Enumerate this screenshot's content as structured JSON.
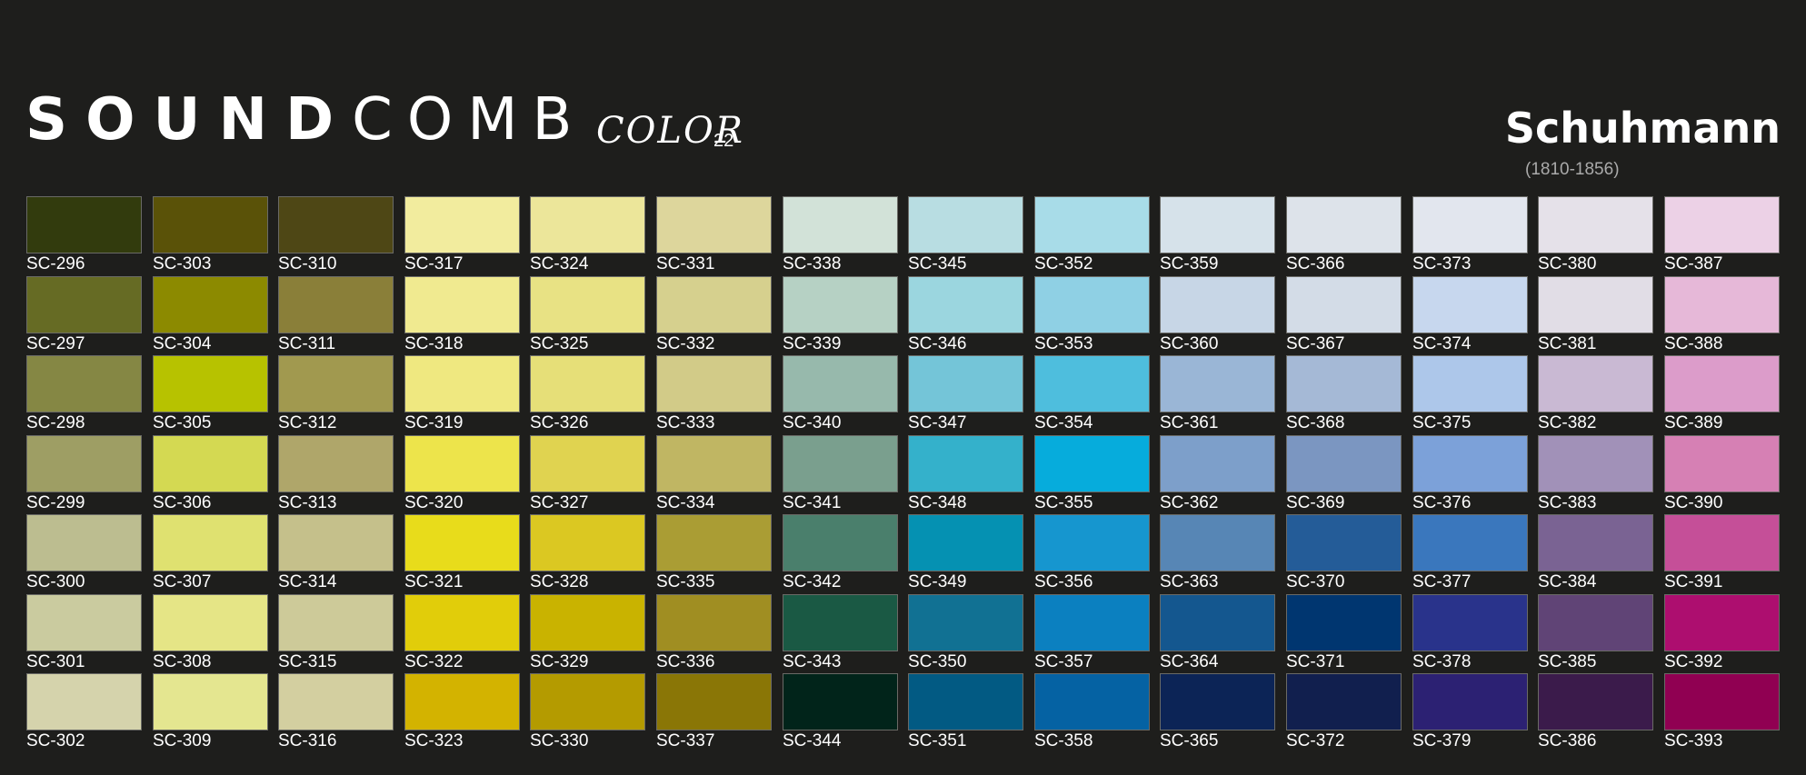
{
  "header": {
    "brand_bold": "SOUND",
    "brand_light": "COMB",
    "collection": "COLOR",
    "collection_number": "22",
    "maker": "Schuhmann",
    "maker_years": "(1810-1856)"
  },
  "swatch_columns": [
    [
      {
        "code": "SC-296",
        "color": "#323b0d"
      },
      {
        "code": "SC-297",
        "color": "#666b24"
      },
      {
        "code": "SC-298",
        "color": "#858744"
      },
      {
        "code": "SC-299",
        "color": "#9e9e64"
      },
      {
        "code": "SC-300",
        "color": "#bcbd90"
      },
      {
        "code": "SC-301",
        "color": "#cacb9f"
      },
      {
        "code": "SC-302",
        "color": "#d5d3ac"
      }
    ],
    [
      {
        "code": "SC-303",
        "color": "#5a5208"
      },
      {
        "code": "SC-304",
        "color": "#8c8a00"
      },
      {
        "code": "SC-305",
        "color": "#b7c200"
      },
      {
        "code": "SC-306",
        "color": "#d4d952"
      },
      {
        "code": "SC-307",
        "color": "#dfe170"
      },
      {
        "code": "SC-308",
        "color": "#e5e586"
      },
      {
        "code": "SC-309",
        "color": "#e4e690"
      }
    ],
    [
      {
        "code": "SC-310",
        "color": "#4e4715"
      },
      {
        "code": "SC-311",
        "color": "#8a7f39"
      },
      {
        "code": "SC-312",
        "color": "#a1994f"
      },
      {
        "code": "SC-313",
        "color": "#afa66a"
      },
      {
        "code": "SC-314",
        "color": "#c5c08b"
      },
      {
        "code": "SC-315",
        "color": "#cdca99"
      },
      {
        "code": "SC-316",
        "color": "#d3cfa0"
      }
    ],
    [
      {
        "code": "SC-317",
        "color": "#f2ec9e"
      },
      {
        "code": "SC-318",
        "color": "#f0ea90"
      },
      {
        "code": "SC-319",
        "color": "#efe880"
      },
      {
        "code": "SC-320",
        "color": "#ede44b"
      },
      {
        "code": "SC-321",
        "color": "#e8dc1b"
      },
      {
        "code": "SC-322",
        "color": "#e1cd0a"
      },
      {
        "code": "SC-323",
        "color": "#d3b300"
      }
    ],
    [
      {
        "code": "SC-324",
        "color": "#ece69a"
      },
      {
        "code": "SC-325",
        "color": "#e8e284"
      },
      {
        "code": "SC-326",
        "color": "#e6df78"
      },
      {
        "code": "SC-327",
        "color": "#e0d350"
      },
      {
        "code": "SC-328",
        "color": "#dbc822"
      },
      {
        "code": "SC-329",
        "color": "#c9b300"
      },
      {
        "code": "SC-330",
        "color": "#b49b00"
      }
    ],
    [
      {
        "code": "SC-331",
        "color": "#ddd69c"
      },
      {
        "code": "SC-332",
        "color": "#d6d08e"
      },
      {
        "code": "SC-333",
        "color": "#d2cb88"
      },
      {
        "code": "SC-334",
        "color": "#c0b663"
      },
      {
        "code": "SC-335",
        "color": "#aa9d34"
      },
      {
        "code": "SC-336",
        "color": "#a08e22"
      },
      {
        "code": "SC-337",
        "color": "#8a7606"
      }
    ],
    [
      {
        "code": "SC-338",
        "color": "#d2e2d8"
      },
      {
        "code": "SC-339",
        "color": "#b6d1c4"
      },
      {
        "code": "SC-340",
        "color": "#97b9ac"
      },
      {
        "code": "SC-341",
        "color": "#7a9f8e"
      },
      {
        "code": "SC-342",
        "color": "#4a7f6c"
      },
      {
        "code": "SC-343",
        "color": "#1a5944"
      },
      {
        "code": "SC-344",
        "color": "#01241a"
      }
    ],
    [
      {
        "code": "SC-345",
        "color": "#b8dde2"
      },
      {
        "code": "SC-346",
        "color": "#9bd6df"
      },
      {
        "code": "SC-347",
        "color": "#74c5d8"
      },
      {
        "code": "SC-348",
        "color": "#34b1cb"
      },
      {
        "code": "SC-349",
        "color": "#0591b2"
      },
      {
        "code": "SC-350",
        "color": "#117193"
      },
      {
        "code": "SC-351",
        "color": "#025a83"
      }
    ],
    [
      {
        "code": "SC-352",
        "color": "#a8dce8"
      },
      {
        "code": "SC-353",
        "color": "#8fd0e4"
      },
      {
        "code": "SC-354",
        "color": "#4ebedd"
      },
      {
        "code": "SC-355",
        "color": "#06acdc"
      },
      {
        "code": "SC-356",
        "color": "#1696cf"
      },
      {
        "code": "SC-357",
        "color": "#0b80c0"
      },
      {
        "code": "SC-358",
        "color": "#0562a3"
      }
    ],
    [
      {
        "code": "SC-359",
        "color": "#d6e2ea"
      },
      {
        "code": "SC-360",
        "color": "#c7d6e6"
      },
      {
        "code": "SC-361",
        "color": "#9ab6d6"
      },
      {
        "code": "SC-362",
        "color": "#7d9fca"
      },
      {
        "code": "SC-363",
        "color": "#5786b5"
      },
      {
        "code": "SC-364",
        "color": "#14578f"
      },
      {
        "code": "SC-365",
        "color": "#0c2456"
      }
    ],
    [
      {
        "code": "SC-366",
        "color": "#dde3ea"
      },
      {
        "code": "SC-367",
        "color": "#d3dce7"
      },
      {
        "code": "SC-368",
        "color": "#a5b9d6"
      },
      {
        "code": "SC-369",
        "color": "#7b96c1"
      },
      {
        "code": "SC-370",
        "color": "#245c98"
      },
      {
        "code": "SC-371",
        "color": "#003670"
      },
      {
        "code": "SC-372",
        "color": "#111f4e"
      }
    ],
    [
      {
        "code": "SC-373",
        "color": "#e2e6ee"
      },
      {
        "code": "SC-374",
        "color": "#c7d7ee"
      },
      {
        "code": "SC-375",
        "color": "#adc7ea"
      },
      {
        "code": "SC-376",
        "color": "#7ca1d9"
      },
      {
        "code": "SC-377",
        "color": "#3a77bd"
      },
      {
        "code": "SC-378",
        "color": "#29338b"
      },
      {
        "code": "SC-379",
        "color": "#2c2173"
      }
    ],
    [
      {
        "code": "SC-380",
        "color": "#e5e1e9"
      },
      {
        "code": "SC-381",
        "color": "#e1dde6"
      },
      {
        "code": "SC-382",
        "color": "#c9b9d3"
      },
      {
        "code": "SC-383",
        "color": "#a191b8"
      },
      {
        "code": "SC-384",
        "color": "#7a6393"
      },
      {
        "code": "SC-385",
        "color": "#604476"
      },
      {
        "code": "SC-386",
        "color": "#3b1b4b"
      }
    ],
    [
      {
        "code": "SC-387",
        "color": "#ecd1e6"
      },
      {
        "code": "SC-388",
        "color": "#e6b8d8"
      },
      {
        "code": "SC-389",
        "color": "#dc9cca"
      },
      {
        "code": "SC-390",
        "color": "#d680b4"
      },
      {
        "code": "SC-391",
        "color": "#c54f98"
      },
      {
        "code": "SC-392",
        "color": "#ad0e6f"
      },
      {
        "code": "SC-393",
        "color": "#900052"
      }
    ]
  ]
}
